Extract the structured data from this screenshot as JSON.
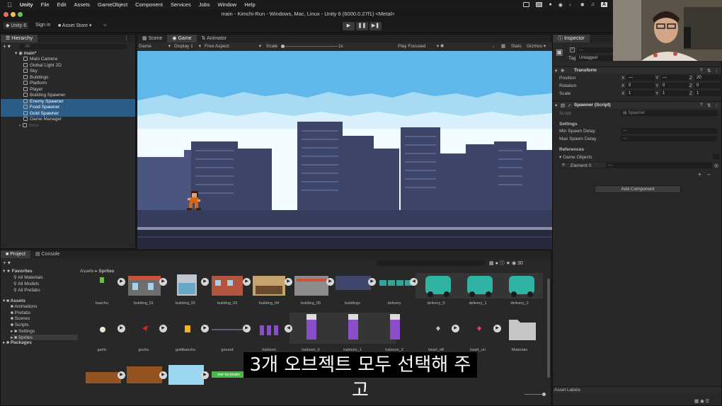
{
  "menubar": {
    "items": [
      "Unity",
      "File",
      "Edit",
      "Assets",
      "GameObject",
      "Component",
      "Services",
      "Jobs",
      "Window",
      "Help"
    ],
    "tray_letter": "A"
  },
  "window": {
    "title": "main - Kimchi-Run - Windows, Mac, Linux - Unity 6 (6000.0.27f1) <Metal>"
  },
  "toolbar": {
    "account": "Unity 6",
    "sign_in": "Sign in",
    "asset_store": "Asset Store"
  },
  "hierarchy": {
    "tab": "Hierarchy",
    "search_placeholder": "All",
    "scene": "main*",
    "items": [
      {
        "label": "Main Camera",
        "selected": false
      },
      {
        "label": "Global Light 2D",
        "selected": false
      },
      {
        "label": "Sky",
        "selected": false
      },
      {
        "label": "Buildings",
        "selected": false
      },
      {
        "label": "Platform",
        "selected": false
      },
      {
        "label": "Player",
        "selected": false
      },
      {
        "label": "Building Spawner",
        "selected": false
      },
      {
        "label": "Enemy Spawner",
        "selected": true
      },
      {
        "label": "Food Spawner",
        "selected": true
      },
      {
        "label": "Gold Spawner",
        "selected": true
      },
      {
        "label": "Game Manager",
        "selected": false
      },
      {
        "label": "Intro",
        "selected": false
      }
    ]
  },
  "center_tabs": [
    "Scene",
    "Game",
    "Animator"
  ],
  "game_toolbar": {
    "mode": "Game",
    "display": "Display 1",
    "aspect": "Free Aspect",
    "scale_label": "Scale",
    "scale_value": "1x",
    "play_focused": "Play Focused",
    "stats": "Stats",
    "gizmos": "Gizmos"
  },
  "inspector": {
    "tab": "Inspector",
    "name_value": "—",
    "tag_label": "Tag",
    "tag_value": "Untagged",
    "transform": {
      "title": "Transform",
      "rows": [
        {
          "label": "Position",
          "x": "—",
          "y": "—",
          "z": "20"
        },
        {
          "label": "Rotation",
          "x": "0",
          "y": "0",
          "z": "0"
        },
        {
          "label": "Scale",
          "x": "1",
          "y": "1",
          "z": "1"
        }
      ]
    },
    "spawner": {
      "title": "Spawner (Script)",
      "script_label": "Script",
      "script_value": "Spawner",
      "settings": "Settings",
      "min_delay": "Min Spawn Delay",
      "max_delay": "Max Spawn Delay",
      "references": "References",
      "game_objects": "Game Objects",
      "element0": "Element 0",
      "element0_value": "—"
    },
    "add_component": "Add Component",
    "asset_labels": "Asset Labels"
  },
  "project": {
    "tabs": [
      "Project",
      "Console"
    ],
    "favorites": "Favorites",
    "fav_items": [
      "All Materials",
      "All Models",
      "All Prefabs"
    ],
    "assets_root": "Assets",
    "asset_folders": [
      "Animations",
      "Prefabs",
      "Scenes",
      "Scripts",
      "Settings",
      "Sprites"
    ],
    "packages": "Packages",
    "breadcrumb": [
      "Assets",
      "Sprites"
    ],
    "count": "30",
    "row1": [
      "baechu",
      "building_01",
      "building_02",
      "building_03",
      "building_04",
      "building_05",
      "buildings",
      "delivery",
      "delivery_0",
      "delivery_1",
      "delivery_2"
    ],
    "row2": [
      "garlic",
      "gochu",
      "goldbaechu",
      "ground",
      "halmoni",
      "halmoni_0",
      "halmoni_1",
      "halmoni_2",
      "heart_off",
      "heart_on",
      "Materials"
    ],
    "tap_to_start": "TAP TO START"
  },
  "subtitle": "3개 오브젝트 모두 선택해 주고",
  "colors": {
    "selection": "#2c5d87",
    "sky": "#61b8e8",
    "building": "#3d4569",
    "ground": "#262a3c"
  }
}
